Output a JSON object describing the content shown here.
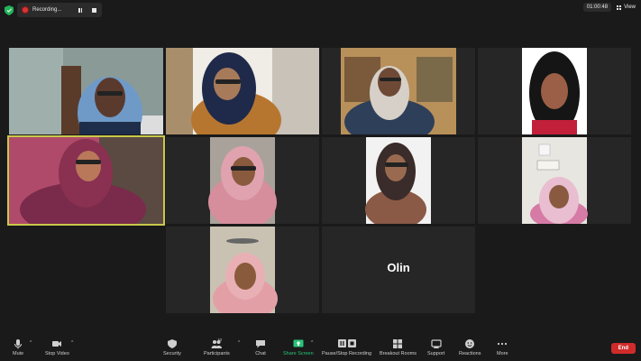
{
  "top": {
    "recording_label": "Recording...",
    "timer": "01:00:48",
    "view_label": "View"
  },
  "tiles": [
    {
      "id": "p1",
      "label": ""
    },
    {
      "id": "p2",
      "label": ""
    },
    {
      "id": "p3",
      "label": ""
    },
    {
      "id": "p4",
      "label": ""
    },
    {
      "id": "p5",
      "label": ""
    },
    {
      "id": "p6",
      "label": ""
    },
    {
      "id": "p7",
      "label": ""
    },
    {
      "id": "p8",
      "label": ""
    },
    {
      "id": "p9",
      "label": ""
    },
    {
      "id": "p10",
      "label": "Olin"
    }
  ],
  "toolbar": {
    "mute": "Mute",
    "stop_video": "Stop Video",
    "security": "Security",
    "participants": "Participants",
    "participants_count": "10",
    "chat": "Chat",
    "share_screen": "Share Screen",
    "pause_stop_recording": "Pause/Stop Recording",
    "breakout_rooms": "Breakout Rooms",
    "support": "Support",
    "reactions": "Reactions",
    "more": "More",
    "end": "End"
  },
  "colors": {
    "background": "#1a1a1a",
    "active_speaker_border": "#c8c84a",
    "share_screen_green": "#29c47a",
    "end_red": "#d02b2b",
    "recording_red": "#dd3333"
  }
}
